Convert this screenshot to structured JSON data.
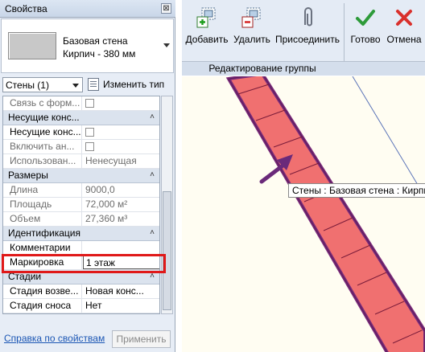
{
  "properties": {
    "title": "Свойства",
    "close_glyph": "⊠",
    "type_name": "Базовая стена",
    "type_sub": "Кирпич - 380 мм",
    "category_filter": "Стены (1)",
    "edit_type_label": "Изменить тип",
    "rows": [
      {
        "label": "Связь с форм...",
        "kind": "checkbox",
        "disabled": true
      },
      {
        "label": "Несущие конс...",
        "kind": "header"
      },
      {
        "label": "Несущие конс...",
        "kind": "checkbox",
        "disabled": false
      },
      {
        "label": "Включить ан...",
        "kind": "checkbox",
        "disabled": true
      },
      {
        "label": "Использован...",
        "value": "Ненесущая",
        "disabled": true
      },
      {
        "label": "Размеры",
        "kind": "header"
      },
      {
        "label": "Длина",
        "value": "9000,0",
        "disabled": true
      },
      {
        "label": "Площадь",
        "value": "72,000 м²",
        "disabled": true
      },
      {
        "label": "Объем",
        "value": "27,360 м³",
        "disabled": true
      },
      {
        "label": "Идентификация",
        "kind": "header"
      },
      {
        "label": "Комментарии",
        "value": "",
        "disabled": false
      },
      {
        "label": "Маркировка",
        "value": "1 этаж",
        "disabled": false
      },
      {
        "label": "Стадии",
        "kind": "header"
      },
      {
        "label": "Стадия возве...",
        "value": "Новая конс...",
        "disabled": false
      },
      {
        "label": "Стадия сноса",
        "value": "Нет",
        "disabled": false
      }
    ],
    "help_link": "Справка по свойствам",
    "apply_button": "Применить"
  },
  "ribbon": {
    "buttons": [
      {
        "label": "Добавить",
        "icon": "add-to-group-icon"
      },
      {
        "label": "Удалить",
        "icon": "remove-from-group-icon"
      },
      {
        "label": "Присоединить",
        "icon": "paperclip-icon"
      },
      {
        "label": "Готово",
        "icon": "checkmark-icon"
      },
      {
        "label": "Отмена",
        "icon": "cancel-x-icon"
      }
    ],
    "group_label": "Редактирование группы"
  },
  "canvas": {
    "tooltip": "Стены : Базовая стена : Кирпич"
  },
  "colors": {
    "wall_fill": "#f07070",
    "wall_outline": "#7a2a7a",
    "highlight": "#e01919",
    "arrow": "#6a2a7a"
  }
}
